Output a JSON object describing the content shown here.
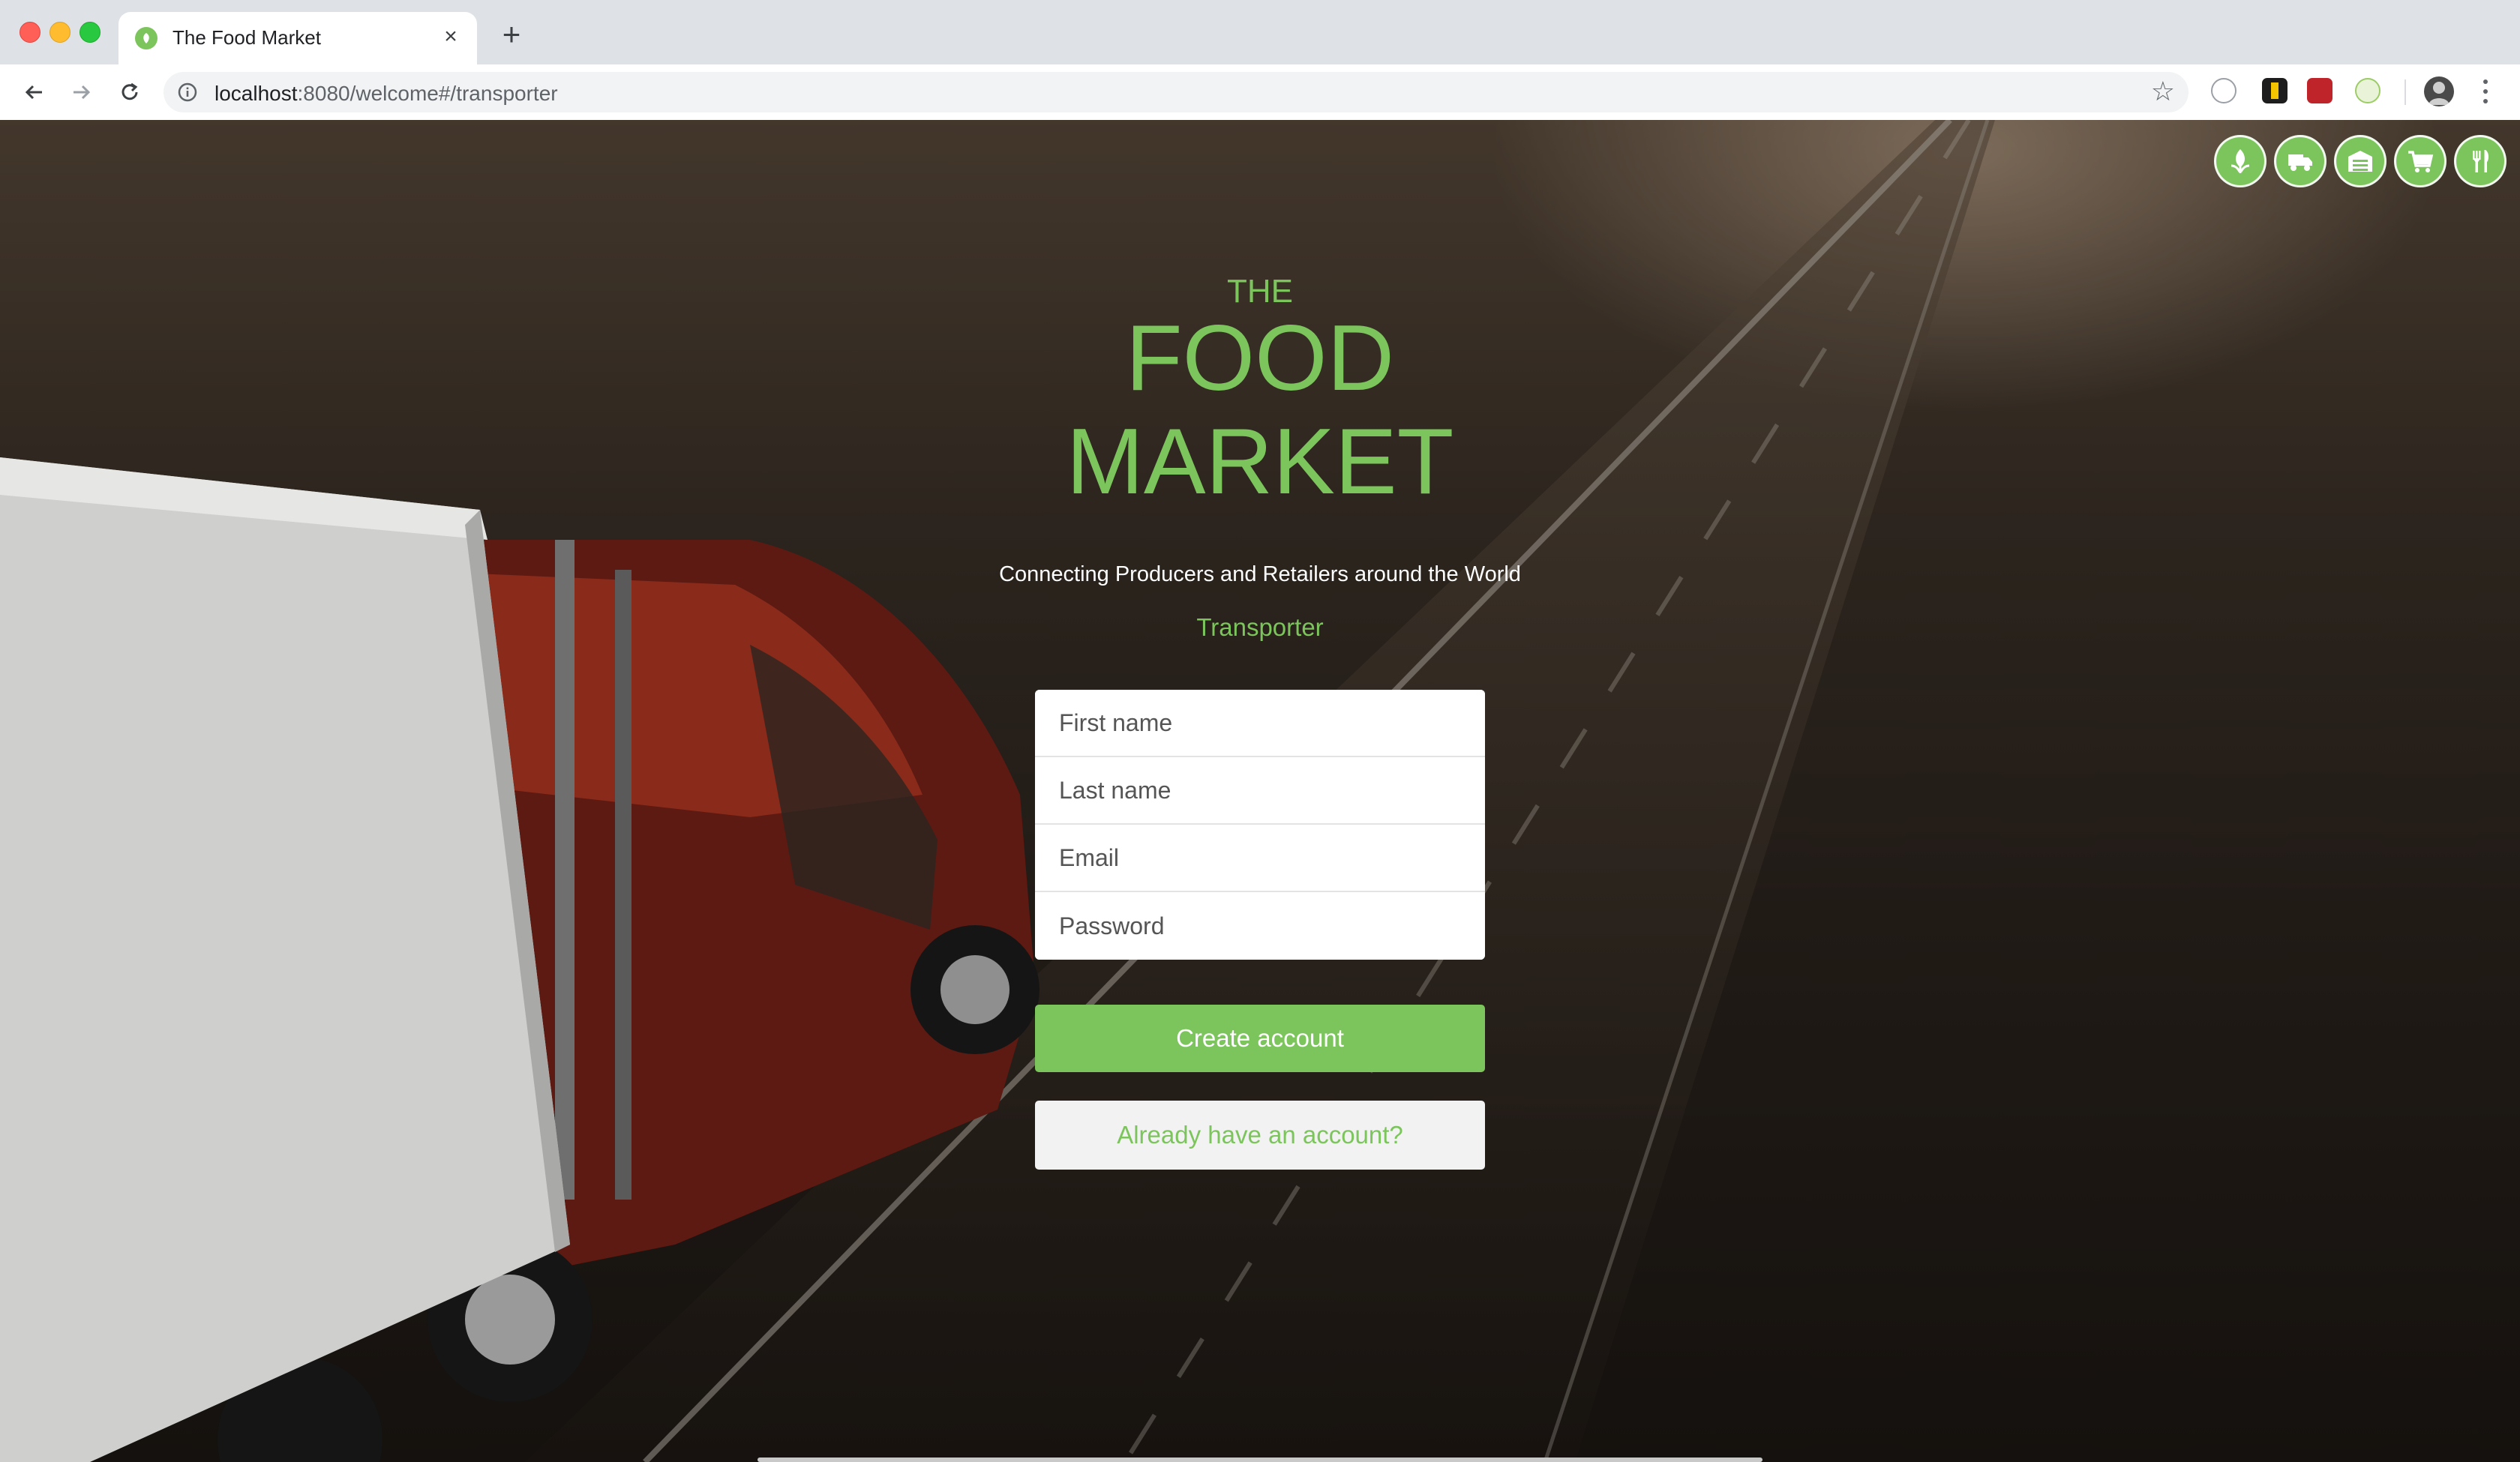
{
  "browser": {
    "tab_title": "The Food Market",
    "url_host": "localhost",
    "url_path": ":8080/welcome#/transporter",
    "new_tab_symbol": "+",
    "close_symbol": "×"
  },
  "role_icons": [
    {
      "name": "producer-icon"
    },
    {
      "name": "transporter-icon"
    },
    {
      "name": "warehouse-icon"
    },
    {
      "name": "retailer-icon"
    },
    {
      "name": "restaurant-icon"
    }
  ],
  "hero": {
    "brand_the": "THE",
    "brand_food": "FOOD",
    "brand_market": "MARKET",
    "tagline": "Connecting Producers and Retailers around the World",
    "role": "Transporter"
  },
  "form": {
    "first_name_placeholder": "First name",
    "last_name_placeholder": "Last name",
    "email_placeholder": "Email",
    "password_placeholder": "Password",
    "create_label": "Create account",
    "login_label": "Already have an account?"
  },
  "colors": {
    "accent": "#7cc45c",
    "chrome": "#dee1e6"
  }
}
